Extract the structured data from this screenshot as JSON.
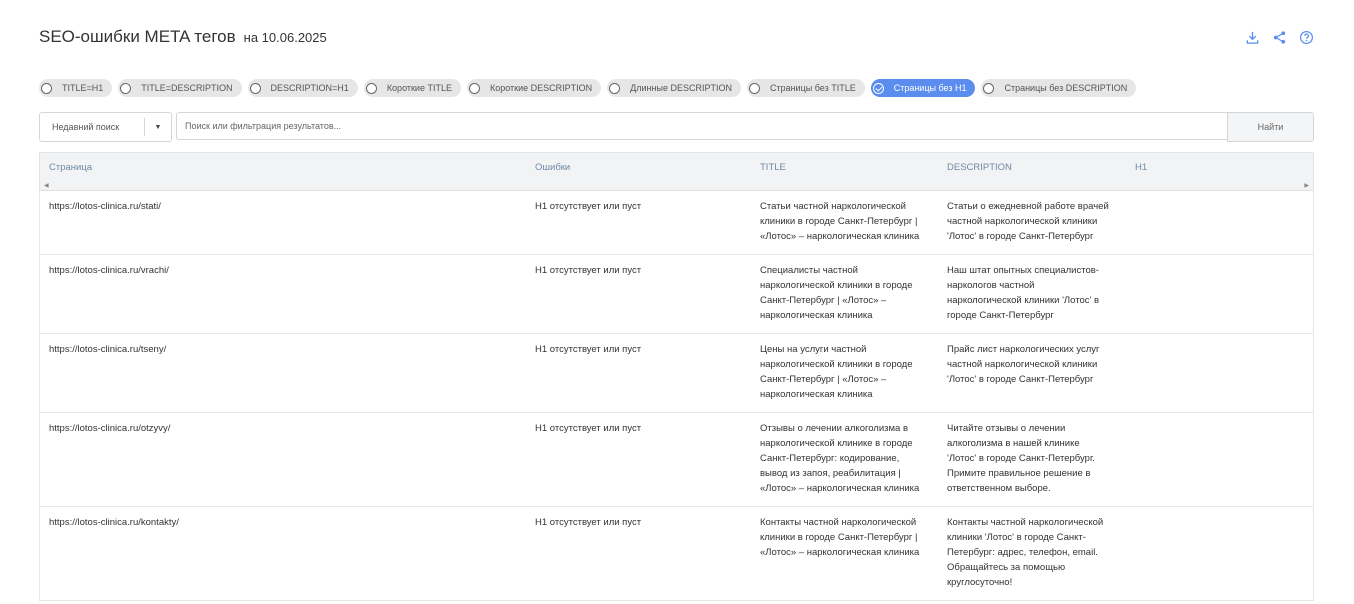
{
  "header": {
    "title": "SEO-ошибки META тегов",
    "date": "на 10.06.2025"
  },
  "toolbar_icons": [
    "download-icon",
    "share-icon",
    "help-icon"
  ],
  "filters": [
    {
      "label": "TITLE=H1",
      "active": false
    },
    {
      "label": "TITLE=DESCRIPTION",
      "active": false
    },
    {
      "label": "DESCRIPTION=H1",
      "active": false
    },
    {
      "label": "Короткие TITLE",
      "active": false
    },
    {
      "label": "Короткие DESCRIPTION",
      "active": false
    },
    {
      "label": "Длинные DESCRIPTION",
      "active": false
    },
    {
      "label": "Страницы без TITLE",
      "active": false
    },
    {
      "label": "Страницы без H1",
      "active": true
    },
    {
      "label": "Страницы без DESCRIPTION",
      "active": false
    }
  ],
  "search": {
    "recent_label": "Недавний поиск",
    "placeholder": "Поиск или фильтрация результатов...",
    "value": "",
    "button": "Найти"
  },
  "accent_color": "#5b8def",
  "table": {
    "columns": [
      "Страница",
      "Ошибки",
      "TITLE",
      "DESCRIPTION",
      "H1"
    ],
    "rows": [
      {
        "page": "https://lotos-clinica.ru/stati/",
        "error": "H1 отсутствует или пуст",
        "title": [
          "Статьи частной наркологической",
          "клиники в городе Санкт-Петербург |",
          "«Лотос» – наркологическая клиника"
        ],
        "description": [
          "Статьи о ежедневной работе врачей",
          "частной наркологической клиники",
          "'Лотос' в городе Санкт-Петербург"
        ],
        "h1": ""
      },
      {
        "page": "https://lotos-clinica.ru/vrachi/",
        "error": "H1 отсутствует или пуст",
        "title": [
          "Специалисты частной",
          "наркологической клиники в городе",
          "Санкт-Петербург | «Лотос» –",
          "наркологическая клиника"
        ],
        "description": [
          "Наш штат опытных специалистов-",
          "наркологов частной",
          "наркологической клиники 'Лотос' в",
          "городе Санкт-Петербург"
        ],
        "h1": ""
      },
      {
        "page": "https://lotos-clinica.ru/tseny/",
        "error": "H1 отсутствует или пуст",
        "title": [
          "Цены на услуги частной",
          "наркологической клиники в городе",
          "Санкт-Петербург | «Лотос» –",
          "наркологическая клиника"
        ],
        "description": [
          "Прайс лист наркологических услуг",
          "частной наркологической клиники",
          "'Лотос' в городе Санкт-Петербург"
        ],
        "h1": ""
      },
      {
        "page": "https://lotos-clinica.ru/otzyvy/",
        "error": "H1 отсутствует или пуст",
        "title": [
          "Отзывы о лечении алкоголизма в",
          "наркологической клинике в городе",
          "Санкт-Петербург: кодирование,",
          "вывод из запоя, реабилитация |",
          "«Лотос» – наркологическая клиника"
        ],
        "description": [
          "Читайте отзывы о лечении",
          "алкоголизма в нашей клинике",
          "'Лотос' в городе Санкт-Петербург.",
          "Примите правильное решение в",
          "ответственном выборе."
        ],
        "h1": ""
      },
      {
        "page": "https://lotos-clinica.ru/kontakty/",
        "error": "H1 отсутствует или пуст",
        "title": [
          "Контакты частной наркологической",
          "клиники в городе Санкт-Петербург |",
          "«Лотос» – наркологическая клиника"
        ],
        "description": [
          "Контакты частной наркологической",
          "клиники 'Лотос' в городе Санкт-",
          "Петербург: адрес, телефон, email.",
          "Обращайтесь за помощью",
          "круглосуточно!"
        ],
        "h1": ""
      }
    ]
  }
}
